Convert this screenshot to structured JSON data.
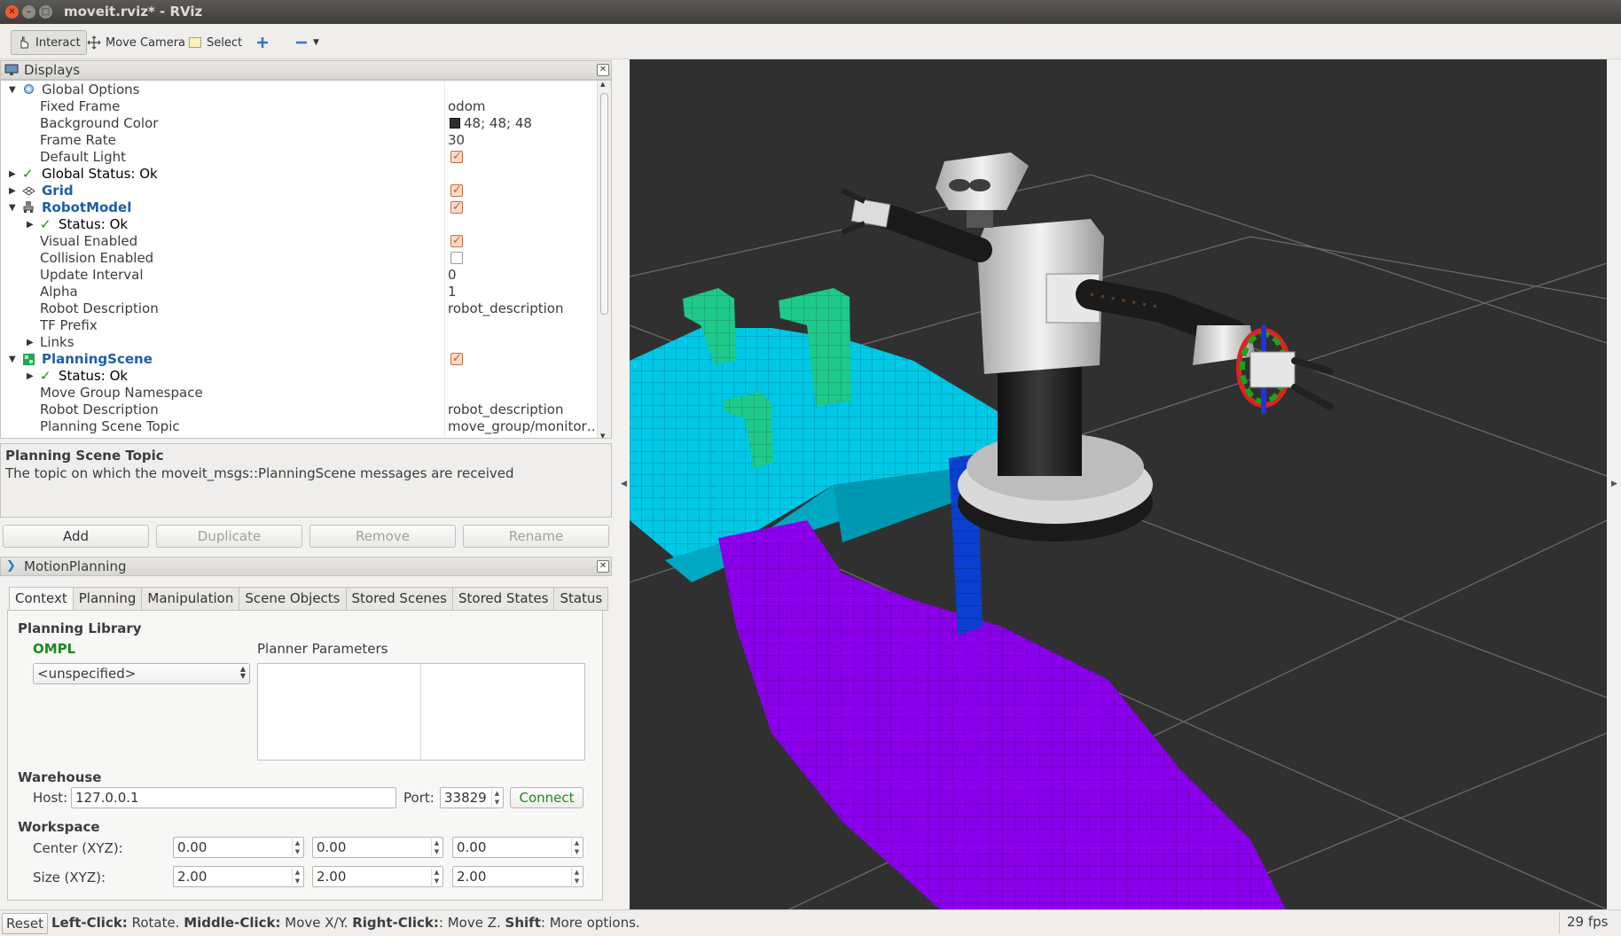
{
  "window": {
    "title": "moveit.rviz* - RViz"
  },
  "toolbar": {
    "interact": "Interact",
    "move_camera": "Move Camera",
    "select": "Select"
  },
  "displays": {
    "title": "Displays",
    "rows": [
      {
        "name": "Global Options",
        "value": ""
      },
      {
        "name": "Fixed Frame",
        "value": "odom"
      },
      {
        "name": "Background Color",
        "value": "48; 48; 48"
      },
      {
        "name": "Frame Rate",
        "value": "30"
      },
      {
        "name": "Default Light",
        "value": ""
      },
      {
        "name": "Global Status: Ok",
        "value": ""
      },
      {
        "name": "Grid",
        "value": ""
      },
      {
        "name": "RobotModel",
        "value": ""
      },
      {
        "name": "Status: Ok",
        "value": ""
      },
      {
        "name": "Visual Enabled",
        "value": ""
      },
      {
        "name": "Collision Enabled",
        "value": ""
      },
      {
        "name": "Update Interval",
        "value": "0"
      },
      {
        "name": "Alpha",
        "value": "1"
      },
      {
        "name": "Robot Description",
        "value": "robot_description"
      },
      {
        "name": "TF Prefix",
        "value": ""
      },
      {
        "name": "Links",
        "value": ""
      },
      {
        "name": "PlanningScene",
        "value": ""
      },
      {
        "name": "Status: Ok",
        "value": ""
      },
      {
        "name": "Move Group Namespace",
        "value": ""
      },
      {
        "name": "Robot Description",
        "value": "robot_description"
      },
      {
        "name": "Planning Scene Topic",
        "value": "move_group/monitor…"
      }
    ],
    "desc_title": "Planning Scene Topic",
    "desc_text": "The topic on which the moveit_msgs::PlanningScene messages are received",
    "buttons": {
      "add": "Add",
      "duplicate": "Duplicate",
      "remove": "Remove",
      "rename": "Rename"
    }
  },
  "motion": {
    "title": "MotionPlanning",
    "tabs": [
      "Context",
      "Planning",
      "Manipulation",
      "Scene Objects",
      "Stored Scenes",
      "Stored States",
      "Status"
    ],
    "planning_library": "Planning Library",
    "ompl": "OMPL",
    "planner_select": "<unspecified>",
    "planner_params": "Planner Parameters",
    "warehouse": "Warehouse",
    "host_label": "Host:",
    "host_value": "127.0.0.1",
    "port_label": "Port:",
    "port_value": "33829",
    "connect": "Connect",
    "workspace": "Workspace",
    "center_label": "Center (XYZ):",
    "center": [
      "0.00",
      "0.00",
      "0.00"
    ],
    "size_label": "Size (XYZ):",
    "size": [
      "2.00",
      "2.00",
      "2.00"
    ]
  },
  "status": {
    "reset": "Reset",
    "hint_1b": "Left-Click:",
    "hint_1": " Rotate. ",
    "hint_2b": "Middle-Click:",
    "hint_2": " Move X/Y. ",
    "hint_3b": "Right-Click:",
    "hint_3": ": Move Z. ",
    "hint_4b": "Shift",
    "hint_4": ": More options.",
    "fps": "29 fps"
  },
  "colors": {
    "background": "#303030",
    "cyan_voxels": "#00c8e6",
    "green_voxels": "#1ec98a",
    "purple_voxels": "#8a00ea",
    "blue_column": "#0a3fd0"
  }
}
